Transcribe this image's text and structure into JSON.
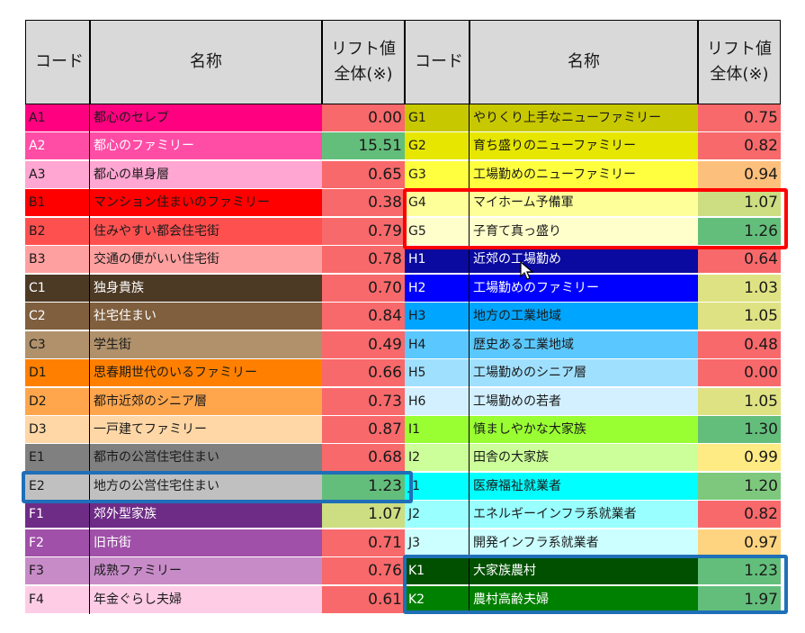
{
  "headers": {
    "code": "コード",
    "name": "名称",
    "lift_line1": "リフト値",
    "lift_line2": "全体(※)"
  },
  "left_rows": [
    {
      "code": "A1",
      "name": "都心のセレブ",
      "lift": "0.00",
      "color": "#ff0080",
      "text": "dark",
      "lift_bg": "#f8696b"
    },
    {
      "code": "A2",
      "name": "都心のファミリー",
      "lift": "15.51",
      "color": "#ff4da6",
      "text": "light",
      "lift_bg": "#63be7b"
    },
    {
      "code": "A3",
      "name": "都心の単身層",
      "lift": "0.65",
      "color": "#ffa6d2",
      "text": "dark",
      "lift_bg": "#f8696b"
    },
    {
      "code": "B1",
      "name": "マンション住まいのファミリー",
      "lift": "0.38",
      "color": "#ff0000",
      "text": "dark",
      "lift_bg": "#f8696b"
    },
    {
      "code": "B2",
      "name": "住みやすい都会住宅街",
      "lift": "0.79",
      "color": "#ff5050",
      "text": "dark",
      "lift_bg": "#f8696b"
    },
    {
      "code": "B3",
      "name": "交通の便がいい住宅街",
      "lift": "0.78",
      "color": "#ffa0a0",
      "text": "dark",
      "lift_bg": "#f8696b"
    },
    {
      "code": "C1",
      "name": "独身貴族",
      "lift": "0.70",
      "color": "#4d3a25",
      "text": "light",
      "lift_bg": "#f8696b"
    },
    {
      "code": "C2",
      "name": "社宅住まい",
      "lift": "0.84",
      "color": "#7f5f3e",
      "text": "light",
      "lift_bg": "#f8696b"
    },
    {
      "code": "C3",
      "name": "学生街",
      "lift": "0.49",
      "color": "#b0916b",
      "text": "dark",
      "lift_bg": "#f8696b"
    },
    {
      "code": "D1",
      "name": "思春期世代のいるファミリー",
      "lift": "0.66",
      "color": "#ff8000",
      "text": "dark",
      "lift_bg": "#f8696b"
    },
    {
      "code": "D2",
      "name": "都市近郊のシニア層",
      "lift": "0.73",
      "color": "#ffa64d",
      "text": "dark",
      "lift_bg": "#f8696b"
    },
    {
      "code": "D3",
      "name": "一戸建てファミリー",
      "lift": "0.87",
      "color": "#ffd7a6",
      "text": "dark",
      "lift_bg": "#f8696b"
    },
    {
      "code": "E1",
      "name": "都市の公営住宅住まい",
      "lift": "0.68",
      "color": "#808080",
      "text": "dark",
      "lift_bg": "#f8696b"
    },
    {
      "code": "E2",
      "name": "地方の公営住宅住まい",
      "lift": "1.23",
      "color": "#c0c0c0",
      "text": "dark",
      "lift_bg": "#63be7b"
    },
    {
      "code": "F1",
      "name": "郊外型家族",
      "lift": "1.07",
      "color": "#6e2c86",
      "text": "light",
      "lift_bg": "#cddd82"
    },
    {
      "code": "F2",
      "name": "旧市街",
      "lift": "0.71",
      "color": "#a050a8",
      "text": "light",
      "lift_bg": "#f8696b"
    },
    {
      "code": "F3",
      "name": "成熟ファミリー",
      "lift": "0.76",
      "color": "#c78bc8",
      "text": "dark",
      "lift_bg": "#f8696b"
    },
    {
      "code": "F4",
      "name": "年金ぐらし夫婦",
      "lift": "0.61",
      "color": "#ffcce6",
      "text": "dark",
      "lift_bg": "#f8696b"
    }
  ],
  "right_rows": [
    {
      "code": "G1",
      "name": "やりくり上手なニューファミリー",
      "lift": "0.75",
      "color": "#c8c800",
      "text": "dark",
      "lift_bg": "#f8696b"
    },
    {
      "code": "G2",
      "name": "育ち盛りのニューファミリー",
      "lift": "0.82",
      "color": "#e6e600",
      "text": "dark",
      "lift_bg": "#f8696b"
    },
    {
      "code": "G3",
      "name": "工場勤めのニューファミリー",
      "lift": "0.94",
      "color": "#ffff40",
      "text": "dark",
      "lift_bg": "#fdc07c"
    },
    {
      "code": "G4",
      "name": "マイホーム予備軍",
      "lift": "1.07",
      "color": "#ffff99",
      "text": "dark",
      "lift_bg": "#cddd82"
    },
    {
      "code": "G5",
      "name": "子育て真っ盛り",
      "lift": "1.26",
      "color": "#ffffcc",
      "text": "dark",
      "lift_bg": "#63be7b"
    },
    {
      "code": "H1",
      "name": "近郊の工場勤め",
      "lift": "0.64",
      "color": "#0a0aa0",
      "text": "light",
      "lift_bg": "#f8696b"
    },
    {
      "code": "H2",
      "name": "工場勤めのファミリー",
      "lift": "1.03",
      "color": "#0000ff",
      "text": "light",
      "lift_bg": "#dfe283"
    },
    {
      "code": "H3",
      "name": "地方の工業地域",
      "lift": "1.05",
      "color": "#00a5ff",
      "text": "dark",
      "lift_bg": "#dfe283"
    },
    {
      "code": "H4",
      "name": "歴史ある工業地域",
      "lift": "0.48",
      "color": "#5ac8ff",
      "text": "dark",
      "lift_bg": "#f8696b"
    },
    {
      "code": "H5",
      "name": "工場勤めのシニア層",
      "lift": "0.00",
      "color": "#a0e0ff",
      "text": "dark",
      "lift_bg": "#f8696b"
    },
    {
      "code": "H6",
      "name": "工場勤めの若者",
      "lift": "1.05",
      "color": "#d2f0ff",
      "text": "dark",
      "lift_bg": "#dfe283"
    },
    {
      "code": "I1",
      "name": "慎ましやかな大家族",
      "lift": "1.30",
      "color": "#99ff33",
      "text": "dark",
      "lift_bg": "#63be7b"
    },
    {
      "code": "I2",
      "name": "田舎の大家族",
      "lift": "0.99",
      "color": "#ccff99",
      "text": "dark",
      "lift_bg": "#ffeb84"
    },
    {
      "code": "J1",
      "name": "医療福祉就業者",
      "lift": "1.20",
      "color": "#00ffff",
      "text": "dark",
      "lift_bg": "#7ec87d"
    },
    {
      "code": "J2",
      "name": "エネルギーインフラ系就業者",
      "lift": "0.82",
      "color": "#99ffff",
      "text": "dark",
      "lift_bg": "#f8696b"
    },
    {
      "code": "J3",
      "name": "開発インフラ系就業者",
      "lift": "0.97",
      "color": "#ccffff",
      "text": "dark",
      "lift_bg": "#ffd480"
    },
    {
      "code": "K1",
      "name": "大家族農村",
      "lift": "1.23",
      "color": "#005000",
      "text": "light",
      "lift_bg": "#63be7b"
    },
    {
      "code": "K2",
      "name": "農村高齢夫婦",
      "lift": "1.97",
      "color": "#008000",
      "text": "light",
      "lift_bg": "#63be7b"
    }
  ],
  "highlight_colors": {
    "red": "#ff0000",
    "blue": "#1f6fb8"
  }
}
